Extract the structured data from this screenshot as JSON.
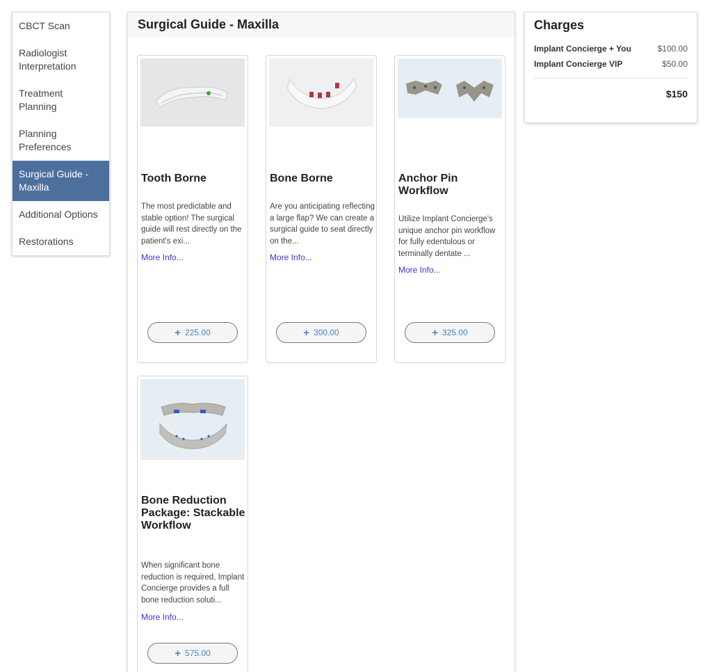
{
  "sidebar": {
    "items": [
      {
        "label": "CBCT Scan",
        "active": false
      },
      {
        "label": "Radiologist Interpretation",
        "active": false
      },
      {
        "label": "Treatment Planning",
        "active": false
      },
      {
        "label": "Planning Preferences",
        "active": false
      },
      {
        "label": "Surgical Guide - Maxilla",
        "active": true
      },
      {
        "label": "Additional Options",
        "active": false
      },
      {
        "label": "Restorations",
        "active": false
      }
    ]
  },
  "main": {
    "title": "Surgical Guide - Maxilla",
    "cards": [
      {
        "title": "Tooth Borne",
        "description": "The most predictable and stable option! The surgical guide will rest directly on the patient's exi...",
        "more": "More Info...",
        "price": "225.00"
      },
      {
        "title": "Bone Borne",
        "description": "Are you anticipating reflecting a large flap? We can create a surgical guide to seat directly on the...",
        "more": "More Info...",
        "price": "300.00"
      },
      {
        "title": "Anchor Pin Workflow",
        "description": "Utilize Implant Concierge's unique anchor pin workflow for fully edentulous or terminally dentate ...",
        "more": "More Info...",
        "price": "325.00"
      },
      {
        "title": "Bone Reduction Package: Stackable Workflow",
        "description": "When significant bone reduction is required, Implant Concierge provides a full bone reduction soluti...",
        "more": "More Info...",
        "price": "575.00"
      }
    ]
  },
  "charges": {
    "title": "Charges",
    "rows": [
      {
        "name": "Implant Concierge + You",
        "amount": "$100.00"
      },
      {
        "name": "Implant Concierge VIP",
        "amount": "$50.00"
      }
    ],
    "total": "$150"
  },
  "colors": {
    "active_nav": "#4d6f9e",
    "link": "#3a36d6",
    "price_text": "#4b84c4"
  },
  "icons": {
    "add": "plus-icon"
  }
}
